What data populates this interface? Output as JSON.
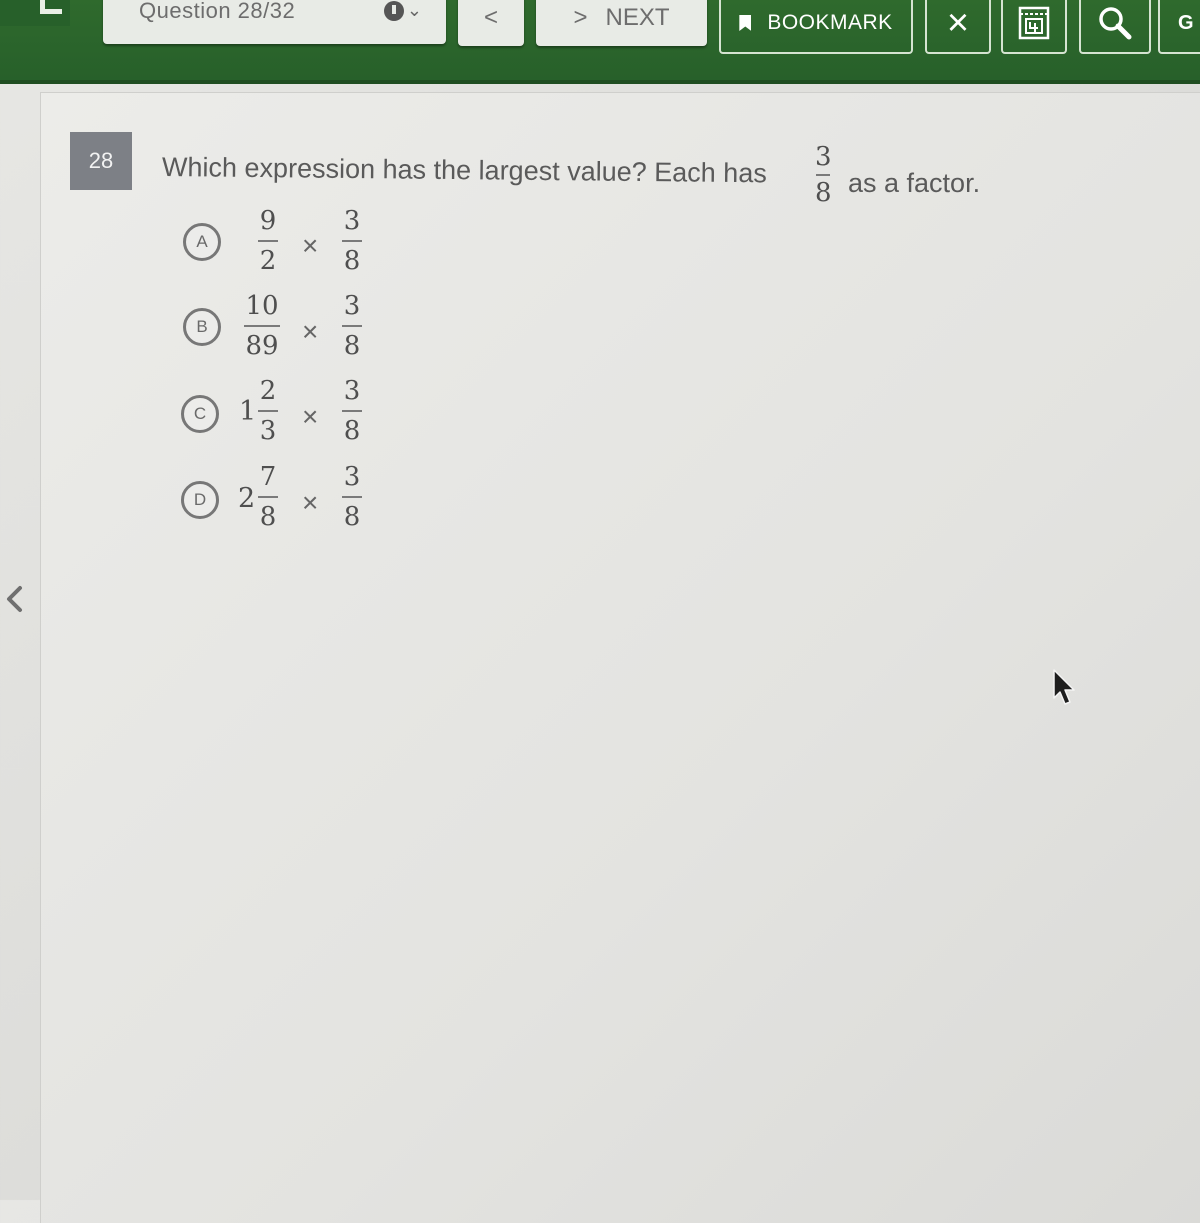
{
  "toolbar": {
    "question_counter": "Question 28/32",
    "prev_label": "<",
    "next_chevron": ">",
    "next_label": "NEXT",
    "bookmark_label": "BOOKMARK",
    "close_label": "×",
    "calculator_icon": "calculator-icon",
    "search_icon": "magnifier-icon",
    "extra_label": "G",
    "colors": {
      "bar": "#2f6a2d",
      "button_face": "#e8ebe6"
    }
  },
  "question": {
    "number": "28",
    "text_before": "Which expression has the largest value? Each has",
    "factor": {
      "numerator": "3",
      "denominator": "8"
    },
    "text_after": "as a factor."
  },
  "options": [
    {
      "letter": "A",
      "whole": "",
      "num": "9",
      "den": "2",
      "times": "×",
      "fnum": "3",
      "fden": "8"
    },
    {
      "letter": "B",
      "whole": "",
      "num": "10",
      "den": "89",
      "times": "×",
      "fnum": "3",
      "fden": "8"
    },
    {
      "letter": "C",
      "whole": "1",
      "num": "2",
      "den": "3",
      "times": "×",
      "fnum": "3",
      "fden": "8"
    },
    {
      "letter": "D",
      "whole": "2",
      "num": "7",
      "den": "8",
      "times": "×",
      "fnum": "3",
      "fden": "8"
    }
  ]
}
